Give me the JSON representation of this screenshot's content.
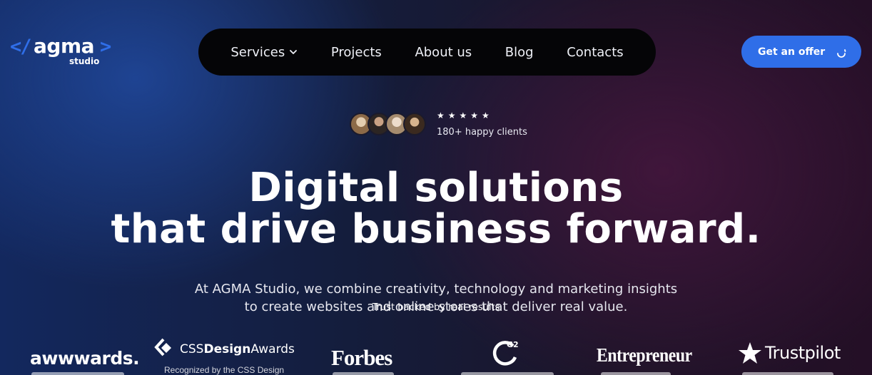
{
  "brand": {
    "logo_open": "</",
    "logo_word": "agma",
    "logo_close": ">",
    "logo_sub": "studio"
  },
  "nav": {
    "items": [
      {
        "label": "Services",
        "has_dropdown": true
      },
      {
        "label": "Projects"
      },
      {
        "label": "About us"
      },
      {
        "label": "Blog"
      },
      {
        "label": "Contacts"
      }
    ]
  },
  "cta": {
    "label": "Get an offer",
    "icon": "loading-spinner-icon"
  },
  "social_proof": {
    "stars": "★★★★★",
    "rating": 5,
    "clients_text": "180+ happy clients"
  },
  "hero": {
    "headline_line1": "Digital solutions",
    "headline_line2": "that drive business forward.",
    "subtext_line1": "At AGMA Studio, we combine creativity, technology and marketing insights",
    "subtext_line2": "to create websites and online stores that deliver real value.",
    "trust_label": "Trust backed by real results"
  },
  "awards": {
    "awwwards": "awwwards.",
    "cssda_prefix": "CSS",
    "cssda_bold": "Design",
    "cssda_suffix": "Awards",
    "cssda_caption": "Recognized by the CSS Design",
    "forbes": "Forbes",
    "g2": "G2",
    "entrepreneur": "Entrepreneur",
    "trustpilot": "Trustpilot"
  },
  "colors": {
    "accent": "#2f6ee8",
    "nav_bg": "#050507"
  }
}
